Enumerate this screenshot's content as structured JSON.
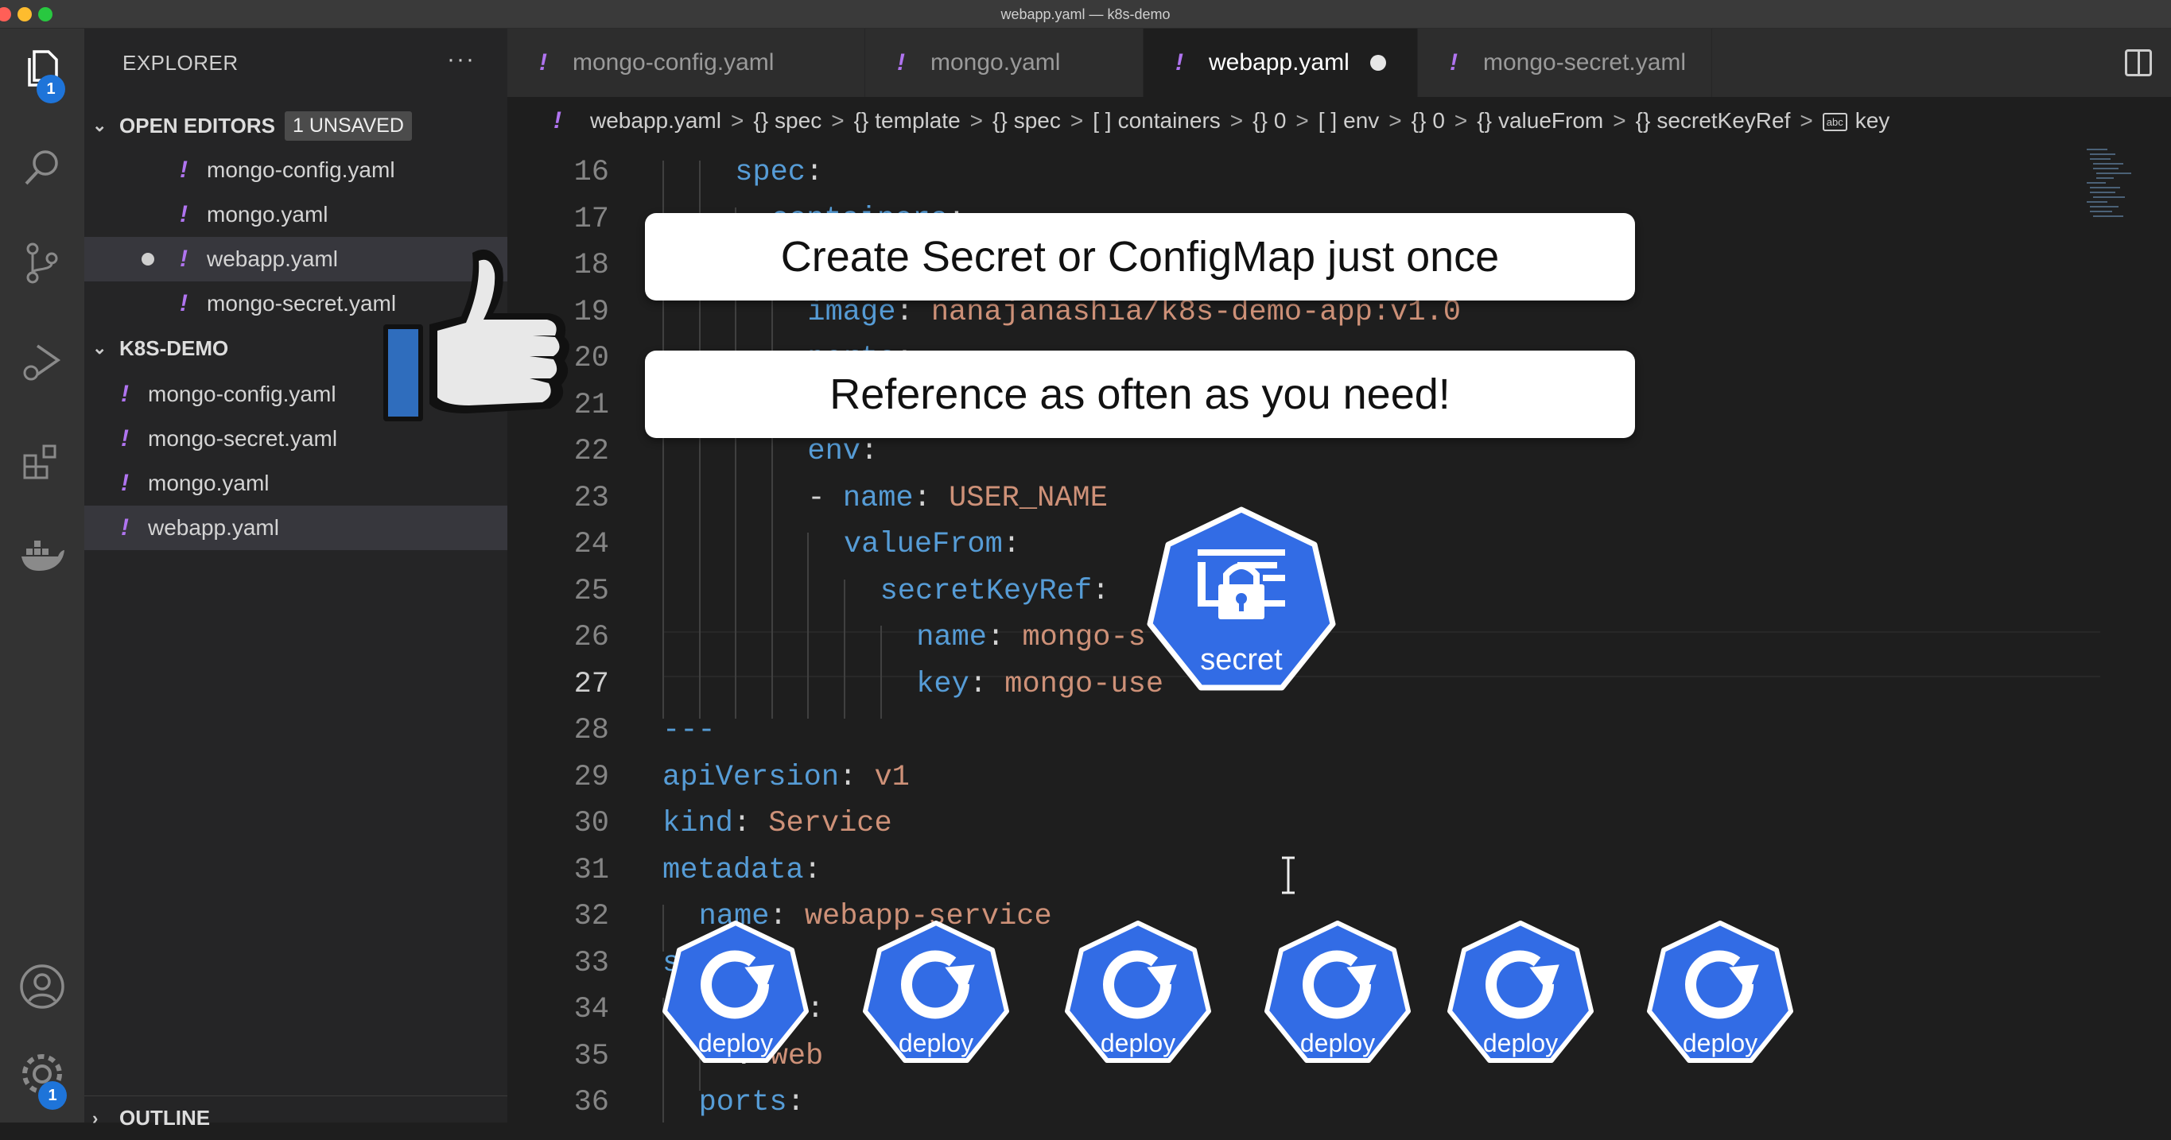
{
  "window": {
    "title": "webapp.yaml — k8s-demo",
    "traffic_lights": [
      "#ff5f57",
      "#febc2e",
      "#28c840"
    ]
  },
  "activity_bar": {
    "items": [
      {
        "icon": "files-icon",
        "badge": "1"
      },
      {
        "icon": "search-icon"
      },
      {
        "icon": "source-control-icon"
      },
      {
        "icon": "run-debug-icon"
      },
      {
        "icon": "extensions-icon"
      },
      {
        "icon": "docker-icon"
      }
    ],
    "bottom": [
      {
        "icon": "account-icon"
      },
      {
        "icon": "manage-gear-icon",
        "badge": "1"
      }
    ]
  },
  "explorer": {
    "title": "EXPLORER",
    "more": "···",
    "open_editors": {
      "label": "OPEN EDITORS",
      "badge": "1 UNSAVED",
      "items": [
        "mongo-config.yaml",
        "mongo.yaml",
        "webapp.yaml",
        "mongo-secret.yaml"
      ]
    },
    "folder": {
      "label": "K8S-DEMO",
      "items": [
        "mongo-config.yaml",
        "mongo-secret.yaml",
        "mongo.yaml",
        "webapp.yaml"
      ]
    },
    "outline": {
      "label": "OUTLINE"
    }
  },
  "tabs": [
    {
      "label": "mongo-config.yaml"
    },
    {
      "label": "mongo.yaml"
    },
    {
      "label": "webapp.yaml",
      "active": true,
      "modified": true
    },
    {
      "label": "mongo-secret.yaml"
    }
  ],
  "breadcrumb": {
    "file": "webapp.yaml",
    "parts": [
      {
        "sym": "{}",
        "label": "spec"
      },
      {
        "sym": "{}",
        "label": "template"
      },
      {
        "sym": "{}",
        "label": "spec"
      },
      {
        "sym": "[ ]",
        "label": "containers"
      },
      {
        "sym": "{}",
        "label": "0"
      },
      {
        "sym": "[ ]",
        "label": "env"
      },
      {
        "sym": "{}",
        "label": "0"
      },
      {
        "sym": "{}",
        "label": "valueFrom"
      },
      {
        "sym": "{}",
        "label": "secretKeyRef"
      }
    ],
    "last": "key",
    "last_icon": "abc"
  },
  "code": {
    "current_line": 27,
    "lines": [
      {
        "n": 16,
        "indent": 2,
        "k": "spec",
        "colon": ":",
        "v": ""
      },
      {
        "n": 17,
        "indent": 3,
        "k": "containers",
        "colon": ":",
        "v": ""
      },
      {
        "n": 18,
        "indent": 3,
        "k": "",
        "colon": "",
        "v": ""
      },
      {
        "n": 19,
        "indent": 4,
        "k": "image",
        "colon": ":",
        "v": " nanajanashia/k8s-demo-app:v1.0"
      },
      {
        "n": 20,
        "indent": 4,
        "k": "ports",
        "colon": ":",
        "v": ""
      },
      {
        "n": 21,
        "indent": 4,
        "k": "",
        "colon": "",
        "v": ""
      },
      {
        "n": 22,
        "indent": 4,
        "k": "env",
        "colon": ":",
        "v": ""
      },
      {
        "n": 23,
        "indent": 4,
        "k": "- name",
        "colon": ":",
        "v": " USER_NAME"
      },
      {
        "n": 24,
        "indent": 5,
        "k": "valueFrom",
        "colon": ":",
        "v": ""
      },
      {
        "n": 25,
        "indent": 6,
        "k": "secretKeyRef",
        "colon": ":",
        "v": ""
      },
      {
        "n": 26,
        "indent": 7,
        "k": "name",
        "colon": ":",
        "v": " mongo-s"
      },
      {
        "n": 27,
        "indent": 7,
        "k": "key",
        "colon": ":",
        "v": " mongo-use"
      },
      {
        "n": 28,
        "indent": 0,
        "k": "---",
        "colon": "",
        "v": ""
      },
      {
        "n": 29,
        "indent": 0,
        "k": "apiVersion",
        "colon": ":",
        "v": " v1"
      },
      {
        "n": 30,
        "indent": 0,
        "k": "kind",
        "colon": ":",
        "v": " Service"
      },
      {
        "n": 31,
        "indent": 0,
        "k": "metadata",
        "colon": ":",
        "v": ""
      },
      {
        "n": 32,
        "indent": 1,
        "k": "name",
        "colon": ":",
        "v": " webapp-service"
      },
      {
        "n": 33,
        "indent": 0,
        "k": "s",
        "colon": "",
        "v": ""
      },
      {
        "n": 34,
        "indent": 3,
        "k": "or",
        "colon": ":",
        "v": ""
      },
      {
        "n": 35,
        "indent": 2,
        "k": "",
        "colon": ":",
        "v": " web"
      },
      {
        "n": 36,
        "indent": 1,
        "k": "ports",
        "colon": ":",
        "v": ""
      }
    ]
  },
  "overlays": {
    "banner1": "Create Secret or ConfigMap just once",
    "banner2": "Reference as often as you need!",
    "secret_label": "secret",
    "deploy_labels": [
      "deploy",
      "deploy",
      "deploy",
      "deploy",
      "deploy",
      "deploy"
    ],
    "thumbs_up": "thumbs-up-icon",
    "k8s_color": "#326ce5"
  }
}
